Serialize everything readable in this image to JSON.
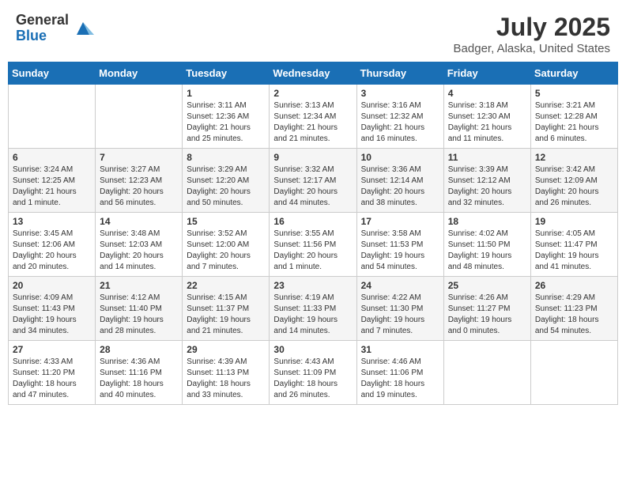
{
  "logo": {
    "general": "General",
    "blue": "Blue"
  },
  "title": "July 2025",
  "location": "Badger, Alaska, United States",
  "weekdays": [
    "Sunday",
    "Monday",
    "Tuesday",
    "Wednesday",
    "Thursday",
    "Friday",
    "Saturday"
  ],
  "weeks": [
    [
      {
        "day": "",
        "info": ""
      },
      {
        "day": "",
        "info": ""
      },
      {
        "day": "1",
        "info": "Sunrise: 3:11 AM\nSunset: 12:36 AM\nDaylight: 21 hours and 25 minutes."
      },
      {
        "day": "2",
        "info": "Sunrise: 3:13 AM\nSunset: 12:34 AM\nDaylight: 21 hours and 21 minutes."
      },
      {
        "day": "3",
        "info": "Sunrise: 3:16 AM\nSunset: 12:32 AM\nDaylight: 21 hours and 16 minutes."
      },
      {
        "day": "4",
        "info": "Sunrise: 3:18 AM\nSunset: 12:30 AM\nDaylight: 21 hours and 11 minutes."
      },
      {
        "day": "5",
        "info": "Sunrise: 3:21 AM\nSunset: 12:28 AM\nDaylight: 21 hours and 6 minutes."
      }
    ],
    [
      {
        "day": "6",
        "info": "Sunrise: 3:24 AM\nSunset: 12:25 AM\nDaylight: 21 hours and 1 minute."
      },
      {
        "day": "7",
        "info": "Sunrise: 3:27 AM\nSunset: 12:23 AM\nDaylight: 20 hours and 56 minutes."
      },
      {
        "day": "8",
        "info": "Sunrise: 3:29 AM\nSunset: 12:20 AM\nDaylight: 20 hours and 50 minutes."
      },
      {
        "day": "9",
        "info": "Sunrise: 3:32 AM\nSunset: 12:17 AM\nDaylight: 20 hours and 44 minutes."
      },
      {
        "day": "10",
        "info": "Sunrise: 3:36 AM\nSunset: 12:14 AM\nDaylight: 20 hours and 38 minutes."
      },
      {
        "day": "11",
        "info": "Sunrise: 3:39 AM\nSunset: 12:12 AM\nDaylight: 20 hours and 32 minutes."
      },
      {
        "day": "12",
        "info": "Sunrise: 3:42 AM\nSunset: 12:09 AM\nDaylight: 20 hours and 26 minutes."
      }
    ],
    [
      {
        "day": "13",
        "info": "Sunrise: 3:45 AM\nSunset: 12:06 AM\nDaylight: 20 hours and 20 minutes."
      },
      {
        "day": "14",
        "info": "Sunrise: 3:48 AM\nSunset: 12:03 AM\nDaylight: 20 hours and 14 minutes."
      },
      {
        "day": "15",
        "info": "Sunrise: 3:52 AM\nSunset: 12:00 AM\nDaylight: 20 hours and 7 minutes."
      },
      {
        "day": "16",
        "info": "Sunrise: 3:55 AM\nSunset: 11:56 PM\nDaylight: 20 hours and 1 minute."
      },
      {
        "day": "17",
        "info": "Sunrise: 3:58 AM\nSunset: 11:53 PM\nDaylight: 19 hours and 54 minutes."
      },
      {
        "day": "18",
        "info": "Sunrise: 4:02 AM\nSunset: 11:50 PM\nDaylight: 19 hours and 48 minutes."
      },
      {
        "day": "19",
        "info": "Sunrise: 4:05 AM\nSunset: 11:47 PM\nDaylight: 19 hours and 41 minutes."
      }
    ],
    [
      {
        "day": "20",
        "info": "Sunrise: 4:09 AM\nSunset: 11:43 PM\nDaylight: 19 hours and 34 minutes."
      },
      {
        "day": "21",
        "info": "Sunrise: 4:12 AM\nSunset: 11:40 PM\nDaylight: 19 hours and 28 minutes."
      },
      {
        "day": "22",
        "info": "Sunrise: 4:15 AM\nSunset: 11:37 PM\nDaylight: 19 hours and 21 minutes."
      },
      {
        "day": "23",
        "info": "Sunrise: 4:19 AM\nSunset: 11:33 PM\nDaylight: 19 hours and 14 minutes."
      },
      {
        "day": "24",
        "info": "Sunrise: 4:22 AM\nSunset: 11:30 PM\nDaylight: 19 hours and 7 minutes."
      },
      {
        "day": "25",
        "info": "Sunrise: 4:26 AM\nSunset: 11:27 PM\nDaylight: 19 hours and 0 minutes."
      },
      {
        "day": "26",
        "info": "Sunrise: 4:29 AM\nSunset: 11:23 PM\nDaylight: 18 hours and 54 minutes."
      }
    ],
    [
      {
        "day": "27",
        "info": "Sunrise: 4:33 AM\nSunset: 11:20 PM\nDaylight: 18 hours and 47 minutes."
      },
      {
        "day": "28",
        "info": "Sunrise: 4:36 AM\nSunset: 11:16 PM\nDaylight: 18 hours and 40 minutes."
      },
      {
        "day": "29",
        "info": "Sunrise: 4:39 AM\nSunset: 11:13 PM\nDaylight: 18 hours and 33 minutes."
      },
      {
        "day": "30",
        "info": "Sunrise: 4:43 AM\nSunset: 11:09 PM\nDaylight: 18 hours and 26 minutes."
      },
      {
        "day": "31",
        "info": "Sunrise: 4:46 AM\nSunset: 11:06 PM\nDaylight: 18 hours and 19 minutes."
      },
      {
        "day": "",
        "info": ""
      },
      {
        "day": "",
        "info": ""
      }
    ]
  ]
}
